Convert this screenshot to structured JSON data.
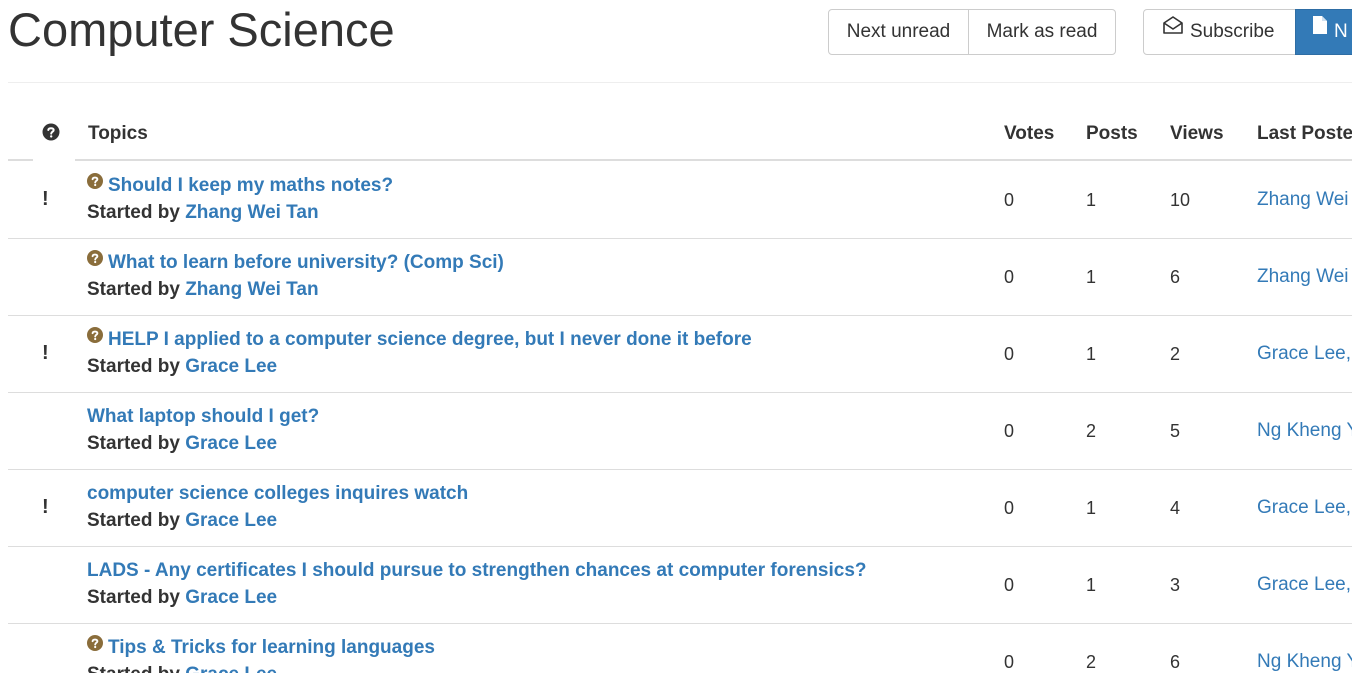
{
  "header": {
    "title": "Computer Science",
    "next_unread_label": "Next unread",
    "mark_as_read_label": "Mark as read",
    "subscribe_label": "Subscribe",
    "new_topic_label": "N"
  },
  "table": {
    "headers": {
      "status": "?",
      "topics": "Topics",
      "votes": "Votes",
      "posts": "Posts",
      "views": "Views",
      "last_poster": "Last Poste"
    },
    "started_by_label": "Started by",
    "rows": [
      {
        "flag": "!",
        "question": true,
        "title": "Should I keep my maths notes?",
        "author": "Zhang Wei Tan",
        "votes": "0",
        "posts": "1",
        "views": "10",
        "last_poster": "Zhang Wei"
      },
      {
        "flag": "",
        "question": true,
        "title": "What to learn before university? (Comp Sci)",
        "author": "Zhang Wei Tan",
        "votes": "0",
        "posts": "1",
        "views": "6",
        "last_poster": "Zhang Wei"
      },
      {
        "flag": "!",
        "question": true,
        "title": "HELP I applied to a computer science degree, but I never done it before",
        "author": "Grace Lee",
        "votes": "0",
        "posts": "1",
        "views": "2",
        "last_poster": "Grace Lee,"
      },
      {
        "flag": "",
        "question": false,
        "title": "What laptop should I get?",
        "author": "Grace Lee",
        "votes": "0",
        "posts": "2",
        "views": "5",
        "last_poster": "Ng Kheng Y"
      },
      {
        "flag": "!",
        "question": false,
        "title": "computer science colleges inquires watch",
        "author": "Grace Lee",
        "votes": "0",
        "posts": "1",
        "views": "4",
        "last_poster": "Grace Lee,"
      },
      {
        "flag": "",
        "question": false,
        "title": "LADS - Any certificates I should pursue to strengthen chances at computer forensics?",
        "author": "Grace Lee",
        "votes": "0",
        "posts": "1",
        "views": "3",
        "last_poster": "Grace Lee,"
      },
      {
        "flag": "",
        "question": true,
        "title": "Tips & Tricks for learning languages",
        "author": "Grace Lee",
        "votes": "0",
        "posts": "2",
        "views": "6",
        "last_poster": "Ng Kheng Y"
      }
    ]
  },
  "colors": {
    "link": "#337ab7",
    "question_icon": "#8a6d3b",
    "primary_button": "#337ab7"
  }
}
